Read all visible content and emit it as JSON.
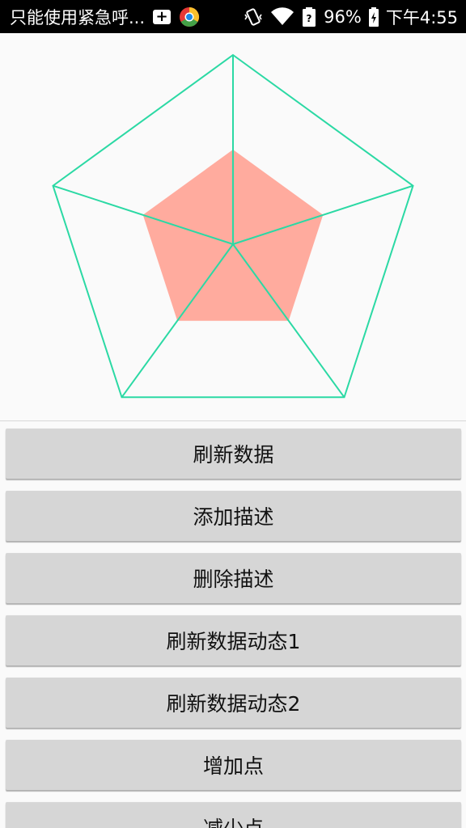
{
  "status_bar": {
    "notification_text": "只能使用紧急呼...",
    "battery_percent": "96%",
    "clock": "下午4:55",
    "icons": [
      "plus-box-icon",
      "app-chrome-icon",
      "vibrate-icon",
      "wifi-icon",
      "battery-icon"
    ]
  },
  "chart_data": {
    "type": "radar",
    "title": "",
    "axes_count": 5,
    "max_value": 1.0,
    "series": [
      {
        "values": [
          0.5,
          0.5,
          0.5,
          0.5,
          0.5
        ],
        "color": "#ffab9e"
      }
    ],
    "web_color": "#2bd9a4",
    "grid": true
  },
  "buttons": [
    {
      "label": "刷新数据"
    },
    {
      "label": "添加描述"
    },
    {
      "label": "删除描述"
    },
    {
      "label": "刷新数据动态1"
    },
    {
      "label": "刷新数据动态2"
    },
    {
      "label": "增加点"
    },
    {
      "label": "减少点"
    }
  ],
  "colors": {
    "status_bar": "#000000",
    "background": "#fafafa",
    "button": "#d6d6d6"
  }
}
